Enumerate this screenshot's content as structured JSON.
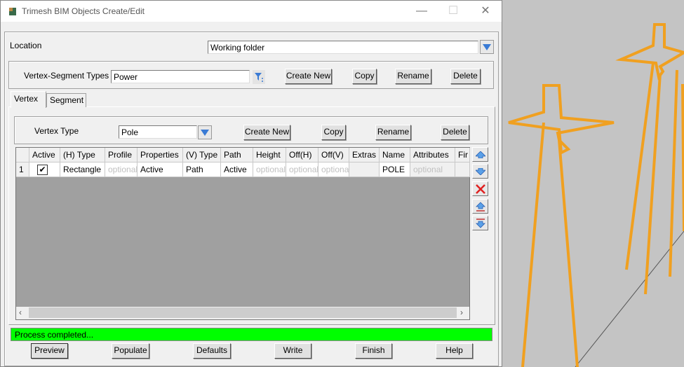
{
  "window": {
    "title": "Trimesh BIM Objects Create/Edit",
    "minimize": "—",
    "maximize": "☐",
    "close": "✕"
  },
  "location": {
    "label": "Location",
    "value": "Working folder"
  },
  "types": {
    "label": "Vertex-Segment Types",
    "value": "Power",
    "create_new": "Create New",
    "copy": "Copy",
    "rename": "Rename",
    "delete": "Delete"
  },
  "tabs": [
    {
      "label": "Vertex"
    },
    {
      "label": "Segment"
    }
  ],
  "vertex": {
    "label": "Vertex Type",
    "value": "Pole",
    "create_new": "Create New",
    "copy": "Copy",
    "rename": "Rename",
    "delete": "Delete"
  },
  "grid": {
    "columns": [
      "",
      "Active",
      "(H) Type",
      "Profile",
      "Properties",
      "(V) Type",
      "Path",
      "Height",
      "Off(H)",
      "Off(V)",
      "Extras",
      "Name",
      "Attributes",
      "Fir"
    ],
    "rows": [
      {
        "num": "1",
        "active": true,
        "h_type": "Rectangle",
        "profile": "optional",
        "properties": "Active",
        "v_type": "Path",
        "path": "Active",
        "height": "optional",
        "off_h": "optional",
        "off_v": "optional",
        "extras": "",
        "name": "POLE",
        "attributes": "optional",
        "fir": ""
      }
    ]
  },
  "status": {
    "text": "Process completed...",
    "color": "#00ff00"
  },
  "buttons": {
    "preview": "Preview",
    "populate": "Populate",
    "defaults": "Defaults",
    "write": "Write",
    "finish": "Finish",
    "help": "Help"
  },
  "colors": {
    "accent_orange": "#f0a020"
  }
}
